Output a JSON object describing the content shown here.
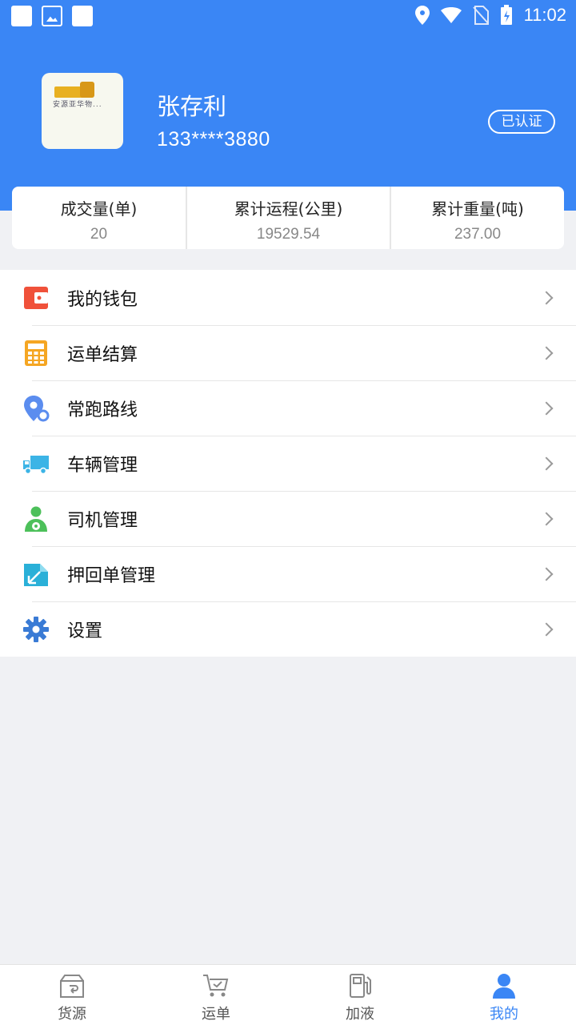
{
  "status_bar": {
    "time": "11:02"
  },
  "profile": {
    "name": "张存利",
    "phone": "133****3880",
    "verified_badge": "已认证",
    "avatar_caption": "安源亚华物..."
  },
  "stats": [
    {
      "label": "成交量(单)",
      "value": "20"
    },
    {
      "label": "累计运程(公里)",
      "value": "19529.54"
    },
    {
      "label": "累计重量(吨)",
      "value": "237.00"
    }
  ],
  "menu": [
    {
      "label": "我的钱包",
      "icon": "wallet-icon"
    },
    {
      "label": "运单结算",
      "icon": "calculator-icon"
    },
    {
      "label": "常跑路线",
      "icon": "route-pin-icon"
    },
    {
      "label": "车辆管理",
      "icon": "truck-icon"
    },
    {
      "label": "司机管理",
      "icon": "driver-icon"
    },
    {
      "label": "押回单管理",
      "icon": "receipt-return-icon"
    },
    {
      "label": "设置",
      "icon": "gear-icon"
    }
  ],
  "tabs": [
    {
      "label": "货源",
      "icon": "cargo-box-icon"
    },
    {
      "label": "运单",
      "icon": "cart-check-icon"
    },
    {
      "label": "加液",
      "icon": "fuel-pump-icon"
    },
    {
      "label": "我的",
      "icon": "user-icon",
      "active": true
    }
  ],
  "colors": {
    "primary": "#3a86f5",
    "background": "#f0f1f4"
  }
}
